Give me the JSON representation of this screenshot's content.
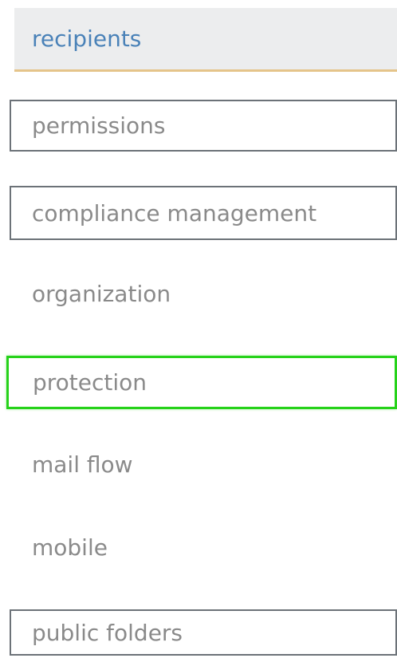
{
  "nav": {
    "items": [
      {
        "label": "recipients",
        "state": "selected"
      },
      {
        "label": "permissions",
        "state": "outlined"
      },
      {
        "label": "compliance management",
        "state": "outlined"
      },
      {
        "label": "organization",
        "state": "normal"
      },
      {
        "label": "protection",
        "state": "highlighted"
      },
      {
        "label": "mail flow",
        "state": "normal"
      },
      {
        "label": "mobile",
        "state": "normal"
      },
      {
        "label": "public folders",
        "state": "outlined"
      }
    ]
  },
  "colors": {
    "selected_text": "#4a82b8",
    "selected_background": "#ecedee",
    "selected_underline": "#e5c48a",
    "item_text": "#8a8a8a",
    "outline_border": "#6c7278",
    "highlight_border": "#26d21a"
  }
}
